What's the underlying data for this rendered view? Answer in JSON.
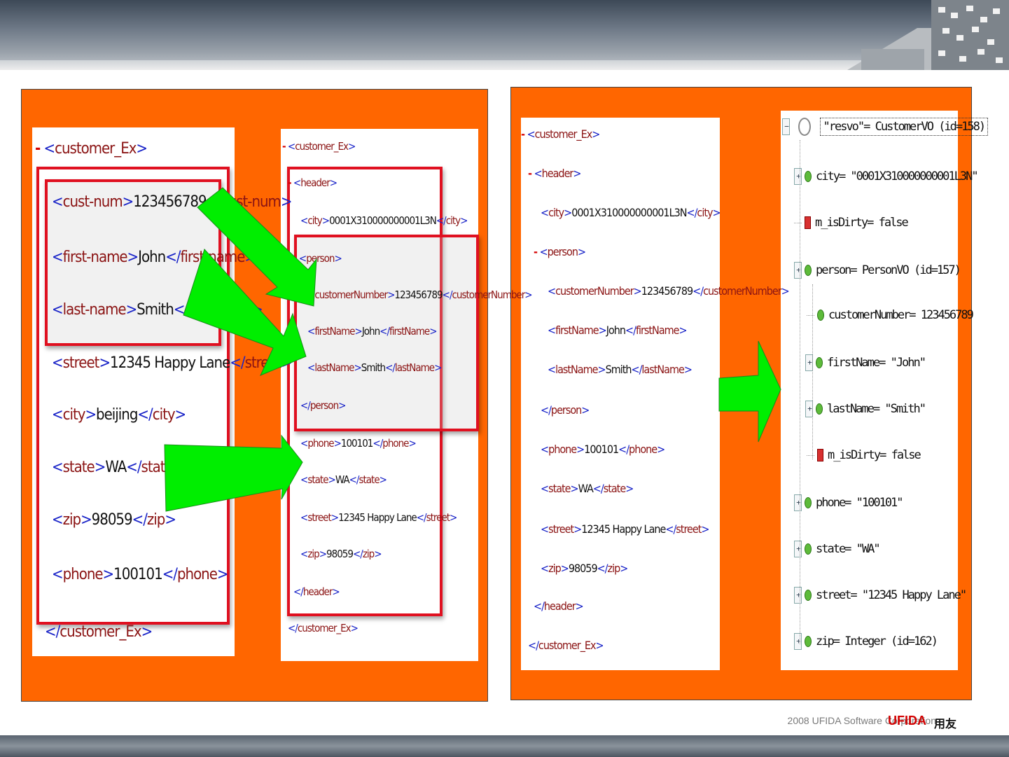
{
  "left_xml": {
    "lines": [
      {
        "minus": "-",
        "open": "customer_Ex",
        "text": "",
        "close": ""
      },
      {
        "minus": "",
        "open": "cust-num",
        "text": "123456789",
        "close": "cust-num"
      },
      {
        "minus": "",
        "open": "first-name",
        "text": "John",
        "close": "first-name"
      },
      {
        "minus": "",
        "open": "last-name",
        "text": "Smith",
        "close": "last-name"
      },
      {
        "minus": "",
        "open": "street",
        "text": "12345 Happy Lane",
        "close": "street"
      },
      {
        "minus": "",
        "open": "city",
        "text": "beijing",
        "close": "city"
      },
      {
        "minus": "",
        "open": "state",
        "text": "WA",
        "close": "state"
      },
      {
        "minus": "",
        "open": "zip",
        "text": "98059",
        "close": "zip"
      },
      {
        "minus": "",
        "open": "phone",
        "text": "100101",
        "close": "phone"
      },
      {
        "minus": "",
        "open": "",
        "text": "",
        "close": "customer_Ex"
      }
    ]
  },
  "mid_xml": {
    "lines": [
      {
        "minus": "-",
        "open": "customer_Ex",
        "text": "",
        "close": ""
      },
      {
        "minus": "-",
        "open": "header",
        "text": "",
        "close": ""
      },
      {
        "minus": "",
        "open": "city",
        "text": "0001X310000000001L3N",
        "close": "city"
      },
      {
        "minus": "-",
        "open": "person",
        "text": "",
        "close": ""
      },
      {
        "minus": "",
        "open": "customerNumber",
        "text": "123456789",
        "close": "customerNumber"
      },
      {
        "minus": "",
        "open": "firstName",
        "text": "John",
        "close": "firstName"
      },
      {
        "minus": "",
        "open": "lastName",
        "text": "Smith",
        "close": "lastName"
      },
      {
        "minus": "",
        "open": "",
        "text": "",
        "close": "person"
      },
      {
        "minus": "",
        "open": "phone",
        "text": "100101",
        "close": "phone"
      },
      {
        "minus": "",
        "open": "state",
        "text": "WA",
        "close": "state"
      },
      {
        "minus": "",
        "open": "street",
        "text": "12345 Happy Lane",
        "close": "street"
      },
      {
        "minus": "",
        "open": "zip",
        "text": "98059",
        "close": "zip"
      },
      {
        "minus": "",
        "open": "",
        "text": "",
        "close": "header"
      },
      {
        "minus": "",
        "open": "",
        "text": "",
        "close": "customer_Ex"
      }
    ]
  },
  "right_xml": {
    "lines": [
      {
        "minus": "-",
        "open": "customer_Ex",
        "text": "",
        "close": ""
      },
      {
        "minus": "-",
        "open": "header",
        "text": "",
        "close": ""
      },
      {
        "minus": "",
        "open": "city",
        "text": "0001X310000000001L3N",
        "close": "city"
      },
      {
        "minus": "-",
        "open": "person",
        "text": "",
        "close": ""
      },
      {
        "minus": "",
        "open": "customerNumber",
        "text": "123456789",
        "close": "customerNumber"
      },
      {
        "minus": "",
        "open": "firstName",
        "text": "John",
        "close": "firstName"
      },
      {
        "minus": "",
        "open": "lastName",
        "text": "Smith",
        "close": "lastName"
      },
      {
        "minus": "",
        "open": "",
        "text": "",
        "close": "person"
      },
      {
        "minus": "",
        "open": "phone",
        "text": "100101",
        "close": "phone"
      },
      {
        "minus": "",
        "open": "state",
        "text": "WA",
        "close": "state"
      },
      {
        "minus": "",
        "open": "street",
        "text": "12345 Happy Lane",
        "close": "street"
      },
      {
        "minus": "",
        "open": "zip",
        "text": "98059",
        "close": "zip"
      },
      {
        "minus": "",
        "open": "",
        "text": "",
        "close": "header"
      },
      {
        "minus": "",
        "open": "",
        "text": "",
        "close": "customer_Ex"
      }
    ]
  },
  "object_tree": {
    "root": "\"resvo\"= CustomerVO  (id=158)",
    "nodes": [
      {
        "text": "city= \"0001X310000000001L3N\"",
        "icon": "green",
        "expander": true
      },
      {
        "text": "m_isDirty= false",
        "icon": "red",
        "expander": false
      },
      {
        "text": "person= PersonVO  (id=157)",
        "icon": "green",
        "expander": true
      },
      {
        "text": "customerNumber= 123456789",
        "icon": "green",
        "expander": false
      },
      {
        "text": "firstName= \"John\"",
        "icon": "green",
        "expander": true
      },
      {
        "text": "lastName= \"Smith\"",
        "icon": "green",
        "expander": true
      },
      {
        "text": "m_isDirty= false",
        "icon": "red",
        "expander": false
      },
      {
        "text": "phone= \"100101\"",
        "icon": "green",
        "expander": true
      },
      {
        "text": "state= \"WA\"",
        "icon": "green",
        "expander": true
      },
      {
        "text": "street= \"12345 Happy Lane\"",
        "icon": "green",
        "expander": true
      },
      {
        "text": "zip= Integer  (id=162)",
        "icon": "green",
        "expander": true
      }
    ]
  },
  "footer": {
    "copyright": "2008 UFIDA Software Corporation",
    "logo": "UFIDA",
    "logo_cn": "用友"
  },
  "colors": {
    "panel": "#ff6600",
    "arrow": "#00ee00",
    "highlight_rect": "#e01020",
    "tag": "#1a24c8",
    "tag_name": "#8b1414"
  }
}
